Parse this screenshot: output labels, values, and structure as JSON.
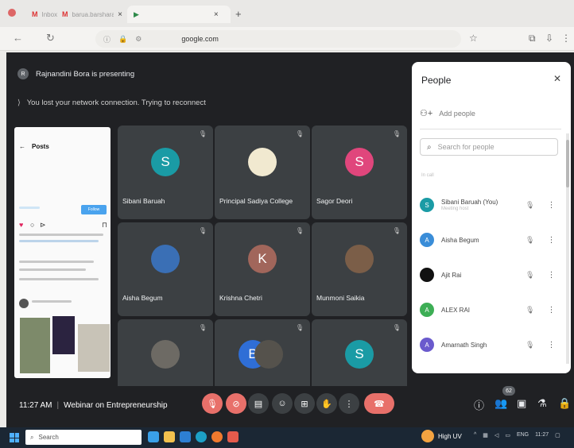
{
  "browser": {
    "tabs": [
      {
        "label": "Inbox",
        "icon": "gmail-icon"
      },
      {
        "label": "barua.barsharani@g...",
        "icon": "gmail-icon"
      },
      {
        "label": "",
        "icon": "meet-icon"
      }
    ],
    "url": "google.com"
  },
  "meet": {
    "presenting_text": "Rajnandini Bora is presenting",
    "presenter_initial": "R",
    "network_message": "You lost your network connection. Trying to reconnect",
    "screen_share": {
      "header": "Posts",
      "follow_label": "Follow"
    },
    "tiles": [
      {
        "name": "Sibani Baruah",
        "initial": "S",
        "color": "#1a9ba5"
      },
      {
        "name": "Principal Sadiya College",
        "initial": "",
        "color": "#f1e9d0"
      },
      {
        "name": "Sagor Deori",
        "initial": "S",
        "color": "#e0467c"
      },
      {
        "name": "Aisha Begum",
        "initial": "",
        "color": "#3a6fb5"
      },
      {
        "name": "Krishna Chetri",
        "initial": "K",
        "color": "#a1665b"
      },
      {
        "name": "Munmoni Saikia",
        "initial": "",
        "color": "#7b5e48"
      },
      {
        "name": "",
        "initial": "",
        "color": "#6d6a64"
      },
      {
        "name": "",
        "initial": "B",
        "color": "#2f6ed6"
      },
      {
        "name": "",
        "initial": "S",
        "color": "#1a9ba5"
      }
    ],
    "clock": "11:27 AM",
    "meeting_title": "Webinar on Entrepreneurship",
    "participant_count": "62"
  },
  "people": {
    "title": "People",
    "add_people": "Add people",
    "search_placeholder": "Search for people",
    "in_call_label": "In call",
    "participants": [
      {
        "name": "Sibani Baruah (You)",
        "sub": "Meeting host",
        "initial": "S",
        "color": "#1a9ba5"
      },
      {
        "name": "Aisha Begum",
        "sub": "",
        "initial": "A",
        "color": "#3a8dd8"
      },
      {
        "name": "Ajit Rai",
        "sub": "",
        "initial": "",
        "color": "#111111"
      },
      {
        "name": "ALEX RAI",
        "sub": "",
        "initial": "A",
        "color": "#3dae55"
      },
      {
        "name": "Amarnath Singh",
        "sub": "",
        "initial": "A",
        "color": "#6a5acd"
      }
    ]
  },
  "taskbar": {
    "search_label": "Search",
    "weather_label": "High UV",
    "lang": "ENG",
    "time": "11:27"
  }
}
